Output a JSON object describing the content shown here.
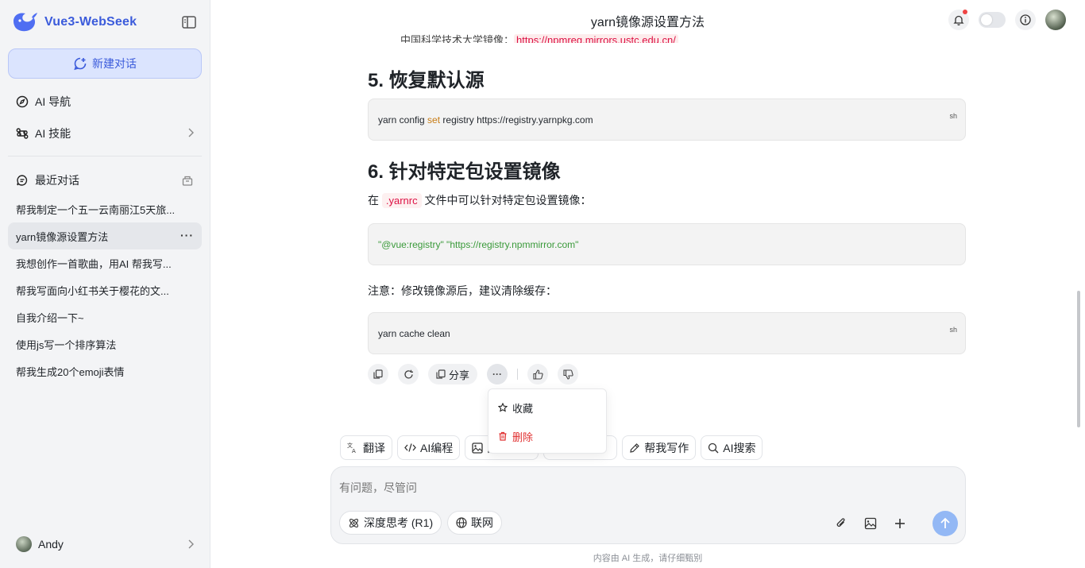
{
  "sidebar": {
    "brand": "Vue3-WebSeek",
    "new_chat": "新建对话",
    "nav": [
      {
        "label": "AI 导航",
        "icon": "compass-icon"
      },
      {
        "label": "AI 技能",
        "icon": "command-icon"
      }
    ],
    "recent_title": "最近对话",
    "history": [
      "帮我制定一个五一云南丽江5天旅...",
      "yarn镜像源设置方法",
      "我想创作一首歌曲，用AI 帮我写...",
      "帮我写面向小红书关于樱花的文...",
      "自我介绍一下~",
      "使用js写一个排序算法",
      "帮我生成20个emoji表情"
    ],
    "active_index": 1,
    "more": "···",
    "user_name": "Andy"
  },
  "header": {
    "title": "yarn镜像源设置方法"
  },
  "content": {
    "cut_line_prefix": "中国科学技术大学镜像：",
    "cut_line_link": "https://npmreg.mirrors.ustc.edu.cn/",
    "h5": "5. 恢复默认源",
    "code1": {
      "a": "yarn config ",
      "kw": "set",
      "b": " registry https://registry.yarnpkg.com",
      "lang": "sh"
    },
    "h6": "6. 针对特定包设置镜像",
    "p1_prefix": "在",
    "p1_code": ".yarnrc",
    "p1_suffix": "文件中可以针对特定包设置镜像：",
    "code2": {
      "str": "\"@vue:registry\" \"https://registry.npmmirror.com\""
    },
    "p2": "注意：修改镜像源后，建议清除缓存：",
    "code3": {
      "text": "yarn cache clean",
      "lang": "sh"
    }
  },
  "actions": {
    "share": "分享",
    "more": "···"
  },
  "popup": {
    "favorite": "收藏",
    "delete": "删除"
  },
  "chips": [
    {
      "label": "翻译",
      "icon": "translate-icon"
    },
    {
      "label": "AI编程",
      "icon": "code-icon"
    },
    {
      "label": "图",
      "icon": "image-icon"
    },
    {
      "label": "",
      "icon": "doc-icon"
    },
    {
      "label": "帮我写作",
      "icon": "pen-icon"
    },
    {
      "label": "AI搜索",
      "icon": "search-icon"
    }
  ],
  "input": {
    "placeholder": "有问题，尽管问",
    "deep_think": "深度思考 (R1)",
    "web": "联网"
  },
  "disclaimer": "内容由 AI 生成，请仔细甄别",
  "colors": {
    "brand": "#3b5bdb",
    "danger": "#e03131",
    "send": "#93b8f5"
  }
}
